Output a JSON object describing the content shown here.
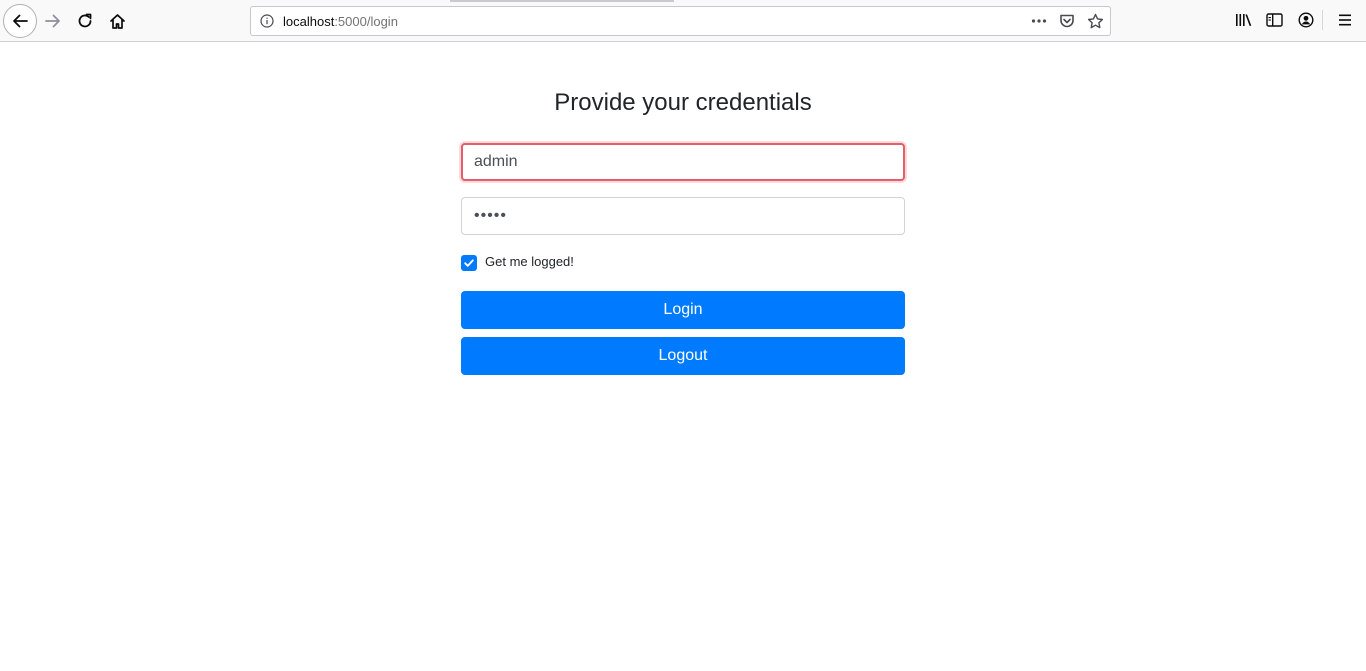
{
  "browser": {
    "url_host": "localhost",
    "url_path": ":5000/login",
    "icons": {
      "back": "back-arrow-icon",
      "forward": "forward-arrow-icon",
      "reload": "reload-icon",
      "home": "home-icon",
      "info": "info-icon",
      "page_actions": "more-horizontal-icon",
      "pocket": "pocket-icon",
      "bookmark": "star-icon",
      "library": "library-icon",
      "sidebar": "sidebar-icon",
      "account": "account-icon",
      "menu": "hamburger-menu-icon"
    }
  },
  "login_form": {
    "heading": "Provide your credentials",
    "username_value": "admin",
    "password_masked": "•••••",
    "remember_checked": true,
    "remember_label": "Get me logged!",
    "login_label": "Login",
    "logout_label": "Logout"
  },
  "colors": {
    "primary": "#007bff",
    "invalid_border": "#e35d6a",
    "text": "#212529"
  }
}
